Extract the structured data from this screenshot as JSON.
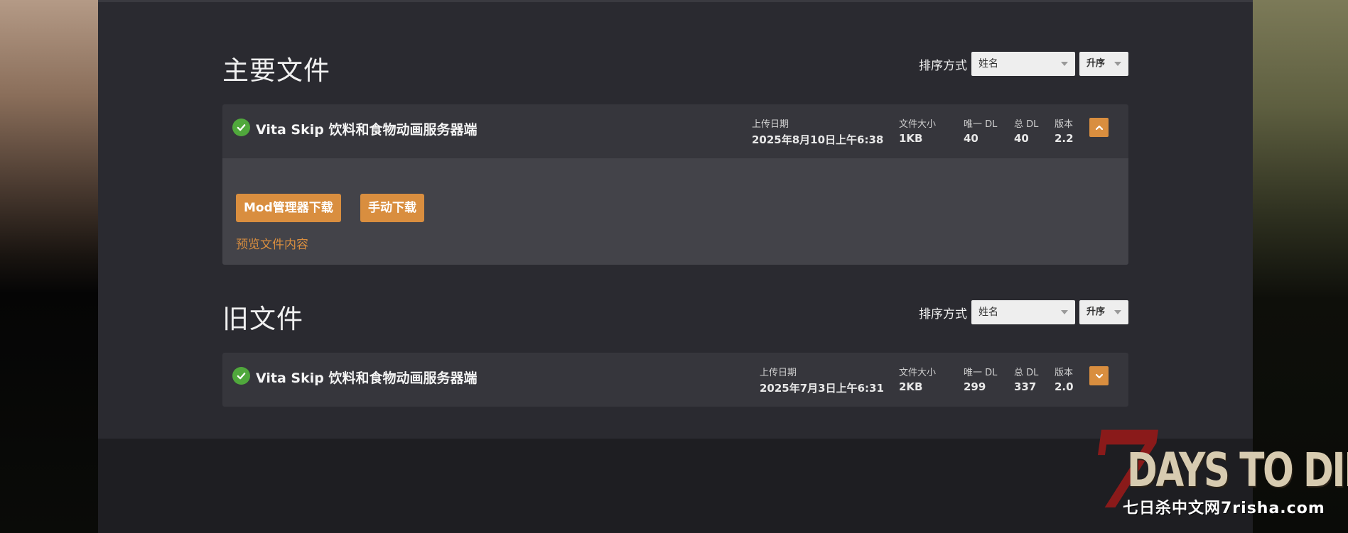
{
  "main_files": {
    "title": "主要文件",
    "sort_label": "排序方式",
    "sort_by": "姓名",
    "sort_order": "升序",
    "file": {
      "name": "Vita Skip 饮料和食物动画服务器端",
      "upload_date_label": "上传日期",
      "upload_date": "2025年8月10日上午6:38",
      "size_label": "文件大小",
      "size": "1KB",
      "unique_dl_label": "唯一 DL",
      "unique_dl": "40",
      "total_dl_label": "总 DL",
      "total_dl": "40",
      "version_label": "版本",
      "version": "2.2",
      "expanded": true,
      "mod_manager_download": "Mod管理器下载",
      "manual_download": "手动下载",
      "preview_contents": "预览文件内容"
    }
  },
  "old_files": {
    "title": "旧文件",
    "sort_label": "排序方式",
    "sort_by": "姓名",
    "sort_order": "升序",
    "file": {
      "name": "Vita Skip 饮料和食物动画服务器端",
      "upload_date_label": "上传日期",
      "upload_date": "2025年7月3日上午6:31",
      "size_label": "文件大小",
      "size": "2KB",
      "unique_dl_label": "唯一 DL",
      "unique_dl": "299",
      "total_dl_label": "总 DL",
      "total_dl": "337",
      "version_label": "版本",
      "version": "2.0",
      "expanded": false
    }
  },
  "watermark": {
    "numeral": "7",
    "logo_text": "DAYS TO DIE",
    "site_text": "七日杀中文网7risha.com"
  },
  "colors": {
    "accent": "#d98e3f",
    "check": "#50a83c",
    "panel": "#2a2a30",
    "card": "#36363c"
  }
}
